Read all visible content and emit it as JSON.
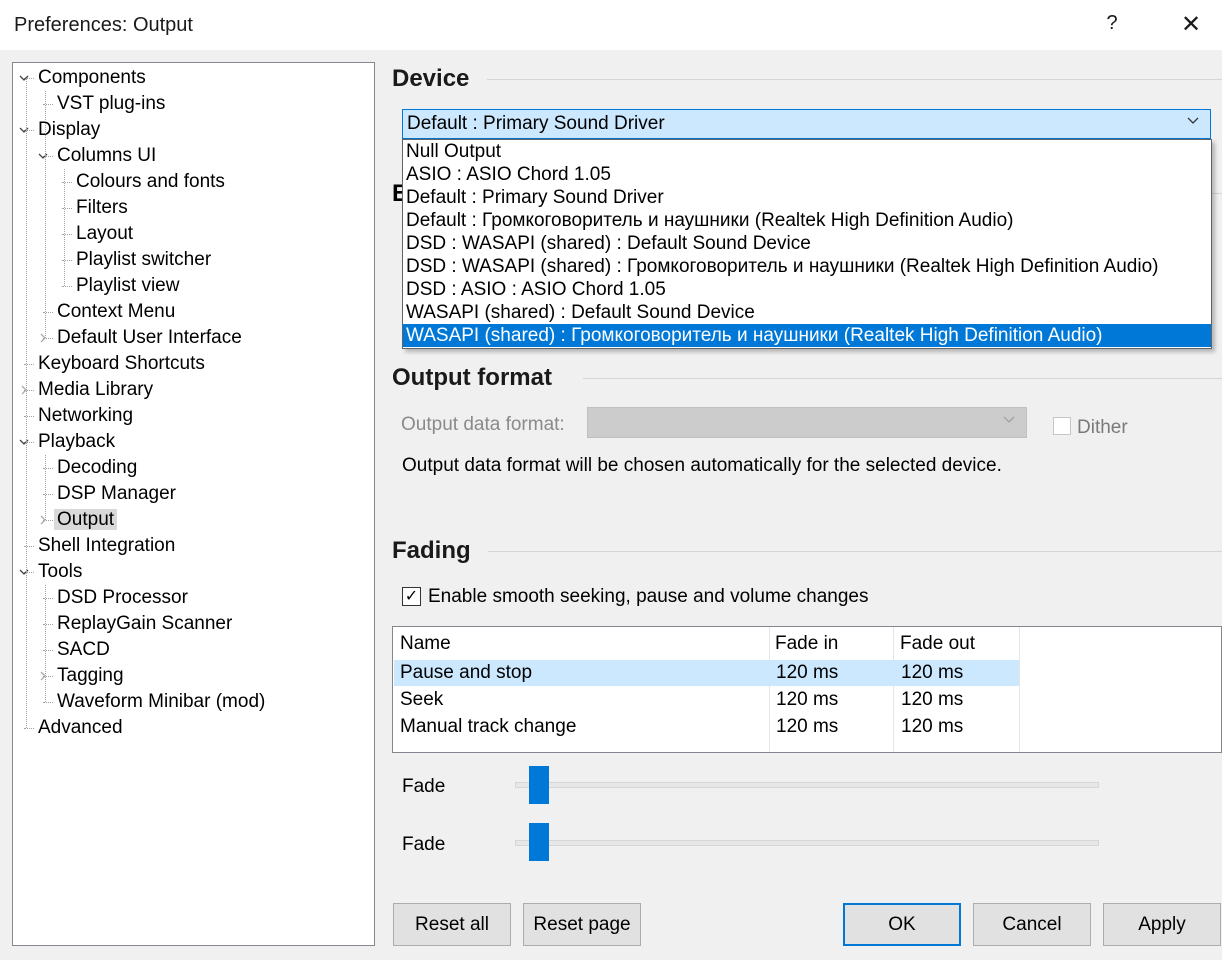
{
  "window": {
    "title": "Preferences: Output",
    "help": "?",
    "close": "✕"
  },
  "tree": {
    "items": [
      {
        "label": "Components",
        "level": 0,
        "expander": "open"
      },
      {
        "label": "VST plug-ins",
        "level": 1,
        "expander": "none"
      },
      {
        "label": "Display",
        "level": 0,
        "expander": "open"
      },
      {
        "label": "Columns UI",
        "level": 1,
        "expander": "open"
      },
      {
        "label": "Colours and fonts",
        "level": 2,
        "expander": "none"
      },
      {
        "label": "Filters",
        "level": 2,
        "expander": "none"
      },
      {
        "label": "Layout",
        "level": 2,
        "expander": "none"
      },
      {
        "label": "Playlist switcher",
        "level": 2,
        "expander": "none"
      },
      {
        "label": "Playlist view",
        "level": 2,
        "expander": "none"
      },
      {
        "label": "Context Menu",
        "level": 1,
        "expander": "none"
      },
      {
        "label": "Default User Interface",
        "level": 1,
        "expander": "closed"
      },
      {
        "label": "Keyboard Shortcuts",
        "level": 0,
        "expander": "none"
      },
      {
        "label": "Media Library",
        "level": 0,
        "expander": "closed"
      },
      {
        "label": "Networking",
        "level": 0,
        "expander": "none"
      },
      {
        "label": "Playback",
        "level": 0,
        "expander": "open"
      },
      {
        "label": "Decoding",
        "level": 1,
        "expander": "none"
      },
      {
        "label": "DSP Manager",
        "level": 1,
        "expander": "none"
      },
      {
        "label": "Output",
        "level": 1,
        "expander": "closed",
        "selected": true
      },
      {
        "label": "Shell Integration",
        "level": 0,
        "expander": "none"
      },
      {
        "label": "Tools",
        "level": 0,
        "expander": "open"
      },
      {
        "label": "DSD Processor",
        "level": 1,
        "expander": "none"
      },
      {
        "label": "ReplayGain Scanner",
        "level": 1,
        "expander": "none"
      },
      {
        "label": "SACD",
        "level": 1,
        "expander": "none"
      },
      {
        "label": "Tagging",
        "level": 1,
        "expander": "closed"
      },
      {
        "label": "Waveform Minibar (mod)",
        "level": 1,
        "expander": "none"
      },
      {
        "label": "Advanced",
        "level": 0,
        "expander": "none"
      }
    ]
  },
  "device": {
    "section_title": "Device",
    "selected": "Default : Primary Sound Driver",
    "options": [
      "Null Output",
      "ASIO : ASIO Chord  1.05",
      "Default : Primary Sound Driver",
      "Default : Громкоговоритель и наушники (Realtek High Definition Audio)",
      "DSD : WASAPI (shared) : Default Sound Device",
      "DSD : WASAPI (shared) : Громкоговоритель и наушники (Realtek High Definition Audio)",
      "DSD : ASIO : ASIO Chord  1.05",
      "WASAPI (shared) : Default Sound Device",
      "WASAPI (shared) : Громкоговоритель и наушники (Realtek High Definition Audio)"
    ],
    "highlighted_index": 8,
    "obscured_heading_initial": "B"
  },
  "output_format": {
    "section_title": "Output format",
    "data_format_label": "Output data format:",
    "data_format_value": "",
    "dither_label": "Dither",
    "dither_checked": false,
    "note": "Output data format will be chosen automatically for the selected device."
  },
  "fading": {
    "section_title": "Fading",
    "enable_label": "Enable smooth seeking, pause and volume changes",
    "enable_checked": true,
    "check_glyph": "✓",
    "columns": [
      "Name",
      "Fade in",
      "Fade out"
    ],
    "rows": [
      {
        "name": "Pause and stop",
        "fade_in": "120 ms",
        "fade_out": "120 ms",
        "selected": true
      },
      {
        "name": "Seek",
        "fade_in": "120 ms",
        "fade_out": "120 ms"
      },
      {
        "name": "Manual track change",
        "fade_in": "120 ms",
        "fade_out": "120 ms"
      }
    ],
    "sliders": [
      {
        "label": "Fade",
        "value": 0.02
      },
      {
        "label": "Fade",
        "value": 0.02
      }
    ]
  },
  "buttons": {
    "reset_all": "Reset all",
    "reset_page": "Reset page",
    "ok": "OK",
    "cancel": "Cancel",
    "apply": "Apply"
  },
  "colors": {
    "accent": "#0078d7",
    "selection_light": "#cce8ff"
  }
}
